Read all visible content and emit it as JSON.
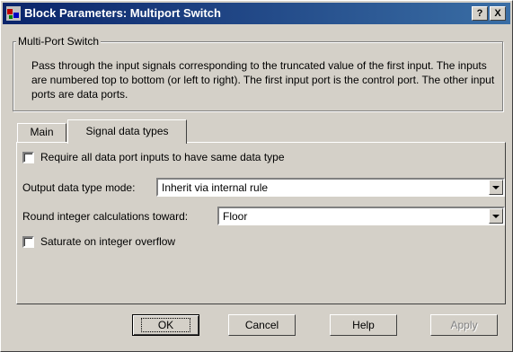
{
  "window": {
    "title": "Block Parameters: Multiport Switch",
    "help_button": "?",
    "close_button": "X"
  },
  "group": {
    "label": "Multi-Port Switch",
    "description": "Pass through the input signals corresponding to the truncated value of the first input. The inputs are numbered top to bottom (or left to right). The first input port is the control port. The other input ports are data ports."
  },
  "tabs": [
    {
      "label": "Main",
      "active": false
    },
    {
      "label": "Signal data types",
      "active": true
    }
  ],
  "panel": {
    "require_same_type": {
      "label": "Require all data port inputs to have same data type",
      "checked": false
    },
    "output_mode": {
      "label": "Output data type mode:",
      "value": "Inherit via internal rule"
    },
    "round_toward": {
      "label": "Round integer calculations toward:",
      "value": "Floor"
    },
    "saturate": {
      "label": "Saturate on integer overflow",
      "checked": false
    }
  },
  "buttons": {
    "ok": "OK",
    "cancel": "Cancel",
    "help": "Help",
    "apply": "Apply"
  },
  "colors": {
    "title_start": "#0a246a",
    "title_end": "#3a6ea5",
    "face": "#d4d0c8"
  }
}
